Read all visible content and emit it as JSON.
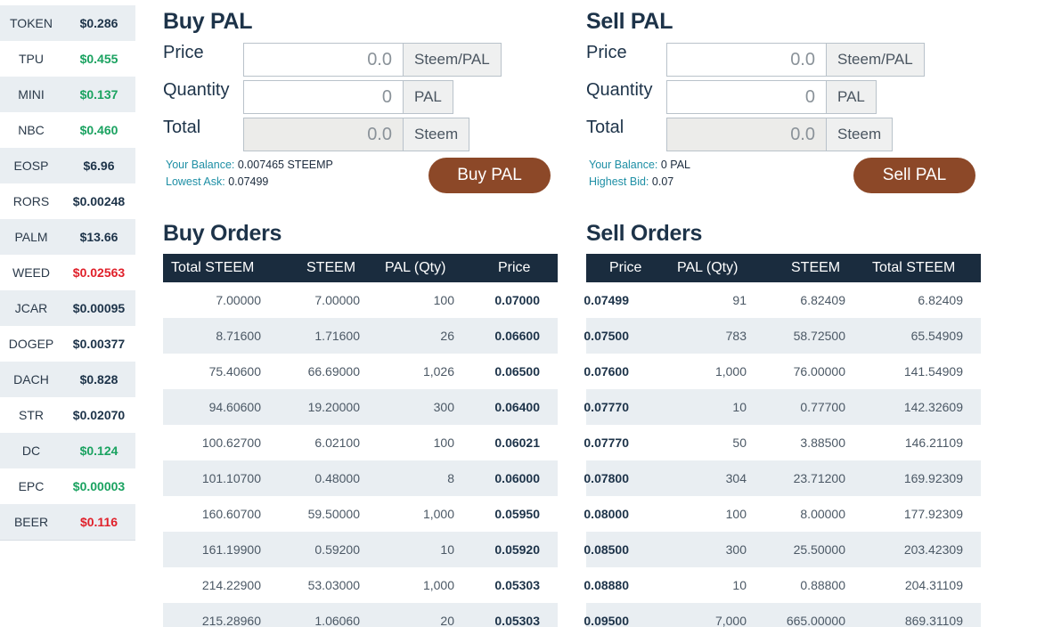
{
  "sidebar": {
    "tokens": [
      {
        "symbol": "TOKEN",
        "price": "$0.286",
        "color": "#1d3349"
      },
      {
        "symbol": "TPU",
        "price": "$0.455",
        "color": "#1aa260"
      },
      {
        "symbol": "MINI",
        "price": "$0.137",
        "color": "#1aa260"
      },
      {
        "symbol": "NBC",
        "price": "$0.460",
        "color": "#1aa260"
      },
      {
        "symbol": "EOSP",
        "price": "$6.96",
        "color": "#1d3349"
      },
      {
        "symbol": "RORS",
        "price": "$0.00248",
        "color": "#1d3349"
      },
      {
        "symbol": "PALM",
        "price": "$13.66",
        "color": "#1d3349"
      },
      {
        "symbol": "WEED",
        "price": "$0.02563",
        "color": "#e0202a"
      },
      {
        "symbol": "JCAR",
        "price": "$0.00095",
        "color": "#1d3349"
      },
      {
        "symbol": "DOGEP",
        "price": "$0.00377",
        "color": "#1d3349"
      },
      {
        "symbol": "DACH",
        "price": "$0.828",
        "color": "#1d3349"
      },
      {
        "symbol": "STR",
        "price": "$0.02070",
        "color": "#1d3349"
      },
      {
        "symbol": "DC",
        "price": "$0.124",
        "color": "#1aa260"
      },
      {
        "symbol": "EPC",
        "price": "$0.00003",
        "color": "#1aa260"
      },
      {
        "symbol": "BEER",
        "price": "$0.116",
        "color": "#e0202a"
      }
    ]
  },
  "buy_form": {
    "title": "Buy PAL",
    "price_label": "Price",
    "price_value": "0.0",
    "price_unit": "Steem/PAL",
    "qty_label": "Quantity",
    "qty_value": "0",
    "qty_unit": "PAL",
    "total_label": "Total",
    "total_value": "0.0",
    "total_unit": "Steem",
    "balance_label": "Your Balance:",
    "balance_value": "0.007465 STEEMP",
    "ask_label": "Lowest Ask:",
    "ask_value": "0.07499",
    "button": "Buy PAL"
  },
  "sell_form": {
    "title": "Sell PAL",
    "price_label": "Price",
    "price_value": "0.0",
    "price_unit": "Steem/PAL",
    "qty_label": "Quantity",
    "qty_value": "0",
    "qty_unit": "PAL",
    "total_label": "Total",
    "total_value": "0.0",
    "total_unit": "Steem",
    "balance_label": "Your Balance:",
    "balance_value": "0 PAL",
    "bid_label": "Highest Bid:",
    "bid_value": "0.07",
    "button": "Sell PAL"
  },
  "buy_orders": {
    "title": "Buy Orders",
    "headers": [
      "Total STEEM",
      "STEEM",
      "PAL (Qty)",
      "Price"
    ],
    "rows": [
      [
        "7.00000",
        "7.00000",
        "100",
        "0.07000"
      ],
      [
        "8.71600",
        "1.71600",
        "26",
        "0.06600"
      ],
      [
        "75.40600",
        "66.69000",
        "1,026",
        "0.06500"
      ],
      [
        "94.60600",
        "19.20000",
        "300",
        "0.06400"
      ],
      [
        "100.62700",
        "6.02100",
        "100",
        "0.06021"
      ],
      [
        "101.10700",
        "0.48000",
        "8",
        "0.06000"
      ],
      [
        "160.60700",
        "59.50000",
        "1,000",
        "0.05950"
      ],
      [
        "161.19900",
        "0.59200",
        "10",
        "0.05920"
      ],
      [
        "214.22900",
        "53.03000",
        "1,000",
        "0.05303"
      ],
      [
        "215.28960",
        "1.06060",
        "20",
        "0.05303"
      ]
    ]
  },
  "sell_orders": {
    "title": "Sell Orders",
    "headers": [
      "Price",
      "PAL (Qty)",
      "STEEM",
      "Total STEEM"
    ],
    "rows": [
      [
        "0.07499",
        "91",
        "6.82409",
        "6.82409"
      ],
      [
        "0.07500",
        "783",
        "58.72500",
        "65.54909"
      ],
      [
        "0.07600",
        "1,000",
        "76.00000",
        "141.54909"
      ],
      [
        "0.07770",
        "10",
        "0.77700",
        "142.32609"
      ],
      [
        "0.07770",
        "50",
        "3.88500",
        "146.21109"
      ],
      [
        "0.07800",
        "304",
        "23.71200",
        "169.92309"
      ],
      [
        "0.08000",
        "100",
        "8.00000",
        "177.92309"
      ],
      [
        "0.08500",
        "300",
        "25.50000",
        "203.42309"
      ],
      [
        "0.08880",
        "10",
        "0.88800",
        "204.31109"
      ],
      [
        "0.09500",
        "7,000",
        "665.00000",
        "869.31109"
      ]
    ]
  }
}
